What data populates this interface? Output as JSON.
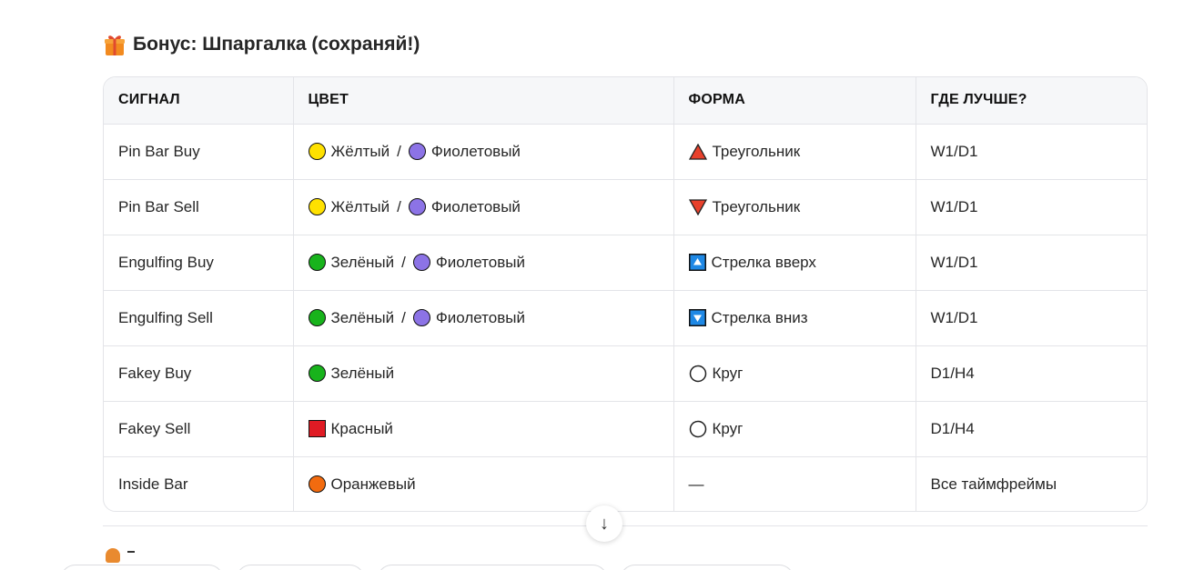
{
  "heading": {
    "emoji_icon": "gift-icon",
    "text": "Бонус: Шпаргалка (сохраняй!)"
  },
  "table": {
    "headers": [
      "СИГНАЛ",
      "ЦВЕТ",
      "ФОРМА",
      "ГДЕ ЛУЧШЕ?"
    ],
    "rows": [
      {
        "signal": "Pin Bar Buy",
        "colors": [
          {
            "label": "Жёлтый",
            "icon": "yellow-circle",
            "hex": "#FFE100",
            "shape": "circle"
          },
          {
            "label": "Фиолетовый",
            "icon": "purple-circle",
            "hex": "#8C73E6",
            "shape": "circle"
          }
        ],
        "shape": {
          "label": "Треугольник",
          "icon": "red-triangle-up-icon"
        },
        "timeframe": "W1/D1"
      },
      {
        "signal": "Pin Bar Sell",
        "colors": [
          {
            "label": "Жёлтый",
            "icon": "yellow-circle",
            "hex": "#FFE100",
            "shape": "circle"
          },
          {
            "label": "Фиолетовый",
            "icon": "purple-circle",
            "hex": "#8C73E6",
            "shape": "circle"
          }
        ],
        "shape": {
          "label": "Треугольник",
          "icon": "red-triangle-down-icon"
        },
        "timeframe": "W1/D1"
      },
      {
        "signal": "Engulfing Buy",
        "colors": [
          {
            "label": "Зелёный",
            "icon": "green-circle",
            "hex": "#18B31C",
            "shape": "circle"
          },
          {
            "label": "Фиолетовый",
            "icon": "purple-circle",
            "hex": "#8C73E6",
            "shape": "circle"
          }
        ],
        "shape": {
          "label": "Стрелка вверх",
          "icon": "up-button-icon"
        },
        "timeframe": "W1/D1"
      },
      {
        "signal": "Engulfing Sell",
        "colors": [
          {
            "label": "Зелёный",
            "icon": "green-circle",
            "hex": "#18B31C",
            "shape": "circle"
          },
          {
            "label": "Фиолетовый",
            "icon": "purple-circle",
            "hex": "#8C73E6",
            "shape": "circle"
          }
        ],
        "shape": {
          "label": "Стрелка вниз",
          "icon": "down-button-icon"
        },
        "timeframe": "W1/D1"
      },
      {
        "signal": "Fakey Buy",
        "colors": [
          {
            "label": "Зелёный",
            "icon": "green-circle",
            "hex": "#18B31C",
            "shape": "circle"
          }
        ],
        "shape": {
          "label": "Круг",
          "icon": "white-circle-icon"
        },
        "timeframe": "D1/H4"
      },
      {
        "signal": "Fakey Sell",
        "colors": [
          {
            "label": "Красный",
            "icon": "red-square",
            "hex": "#E01B24",
            "shape": "square"
          }
        ],
        "shape": {
          "label": "Круг",
          "icon": "white-circle-icon"
        },
        "timeframe": "D1/H4"
      },
      {
        "signal": "Inside Bar",
        "colors": [
          {
            "label": "Оранжевый",
            "icon": "orange-circle",
            "hex": "#F26B0F",
            "shape": "circle"
          }
        ],
        "shape": {
          "label": "—",
          "icon": ""
        },
        "timeframe": "Все таймфреймы"
      }
    ]
  },
  "scroll_button": {
    "icon": "arrow-down-icon",
    "glyph": "↓"
  }
}
